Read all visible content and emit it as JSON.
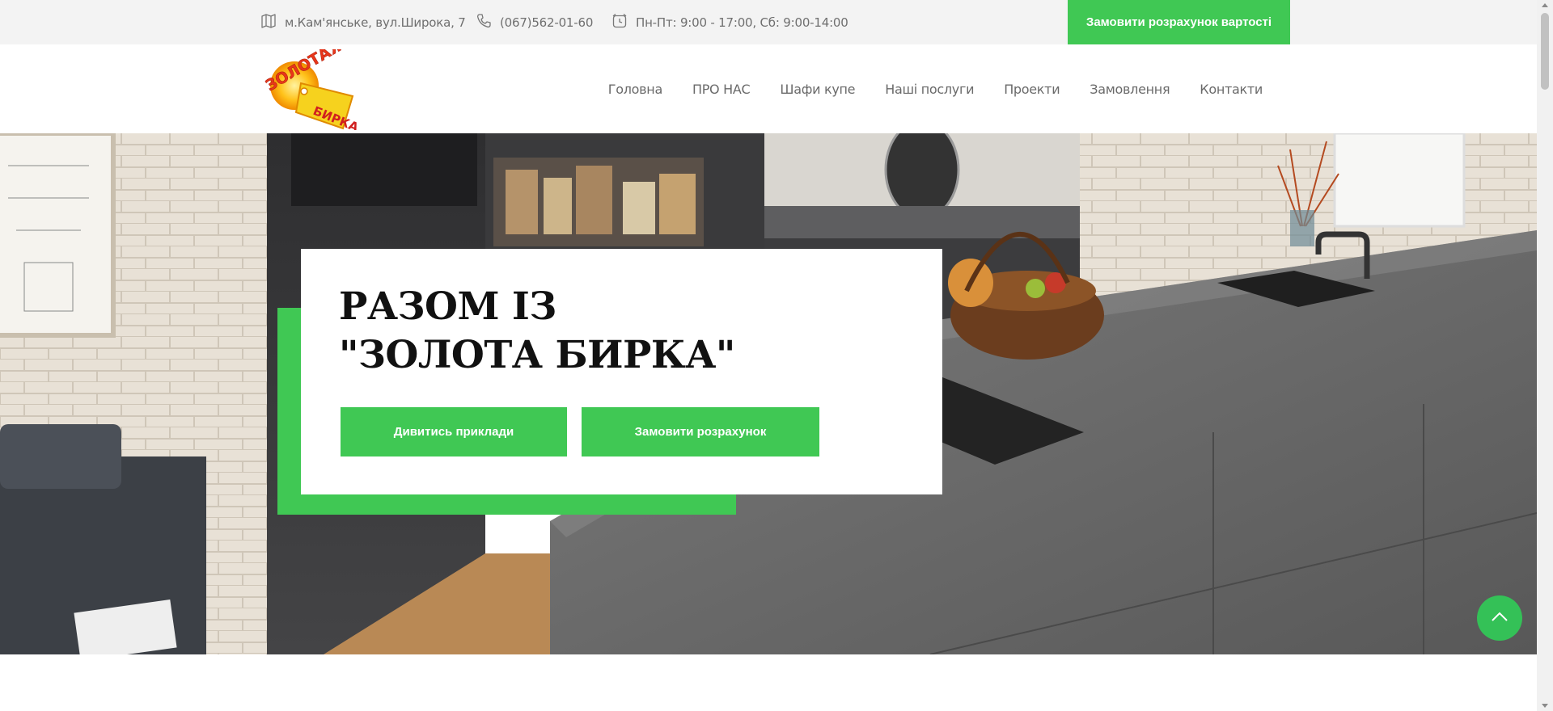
{
  "topbar": {
    "address": "м.Кам'янське, вул.Широка, 7",
    "address_icon": "map-icon",
    "phone": "(067)562-01-60",
    "phone_icon": "phone-icon",
    "hours": "Пн-Пт: 9:00 - 17:00, Сб: 9:00-14:00",
    "hours_icon": "clock-icon",
    "cta_label": "Замовити розрахунок вартості"
  },
  "logo": {
    "top_text": "ЗОЛОТАЯ",
    "tag_text": "БИРКА"
  },
  "nav": {
    "items": [
      {
        "label": "Головна"
      },
      {
        "label": "ПРО НАС"
      },
      {
        "label": "Шафи купе"
      },
      {
        "label": "Наші послуги"
      },
      {
        "label": "Проекти"
      },
      {
        "label": "Замовлення"
      },
      {
        "label": "Контакти"
      }
    ]
  },
  "hero": {
    "title_line1": "РАЗОМ ІЗ",
    "title_line2": "\"ЗОЛОТА БИРКА\"",
    "btn_examples": "Дивитись приклади",
    "btn_order": "Замовити розрахунок"
  },
  "colors": {
    "accent": "#40c854",
    "topbar_bg": "#f3f3f3",
    "text_muted": "#6f6f6f"
  }
}
